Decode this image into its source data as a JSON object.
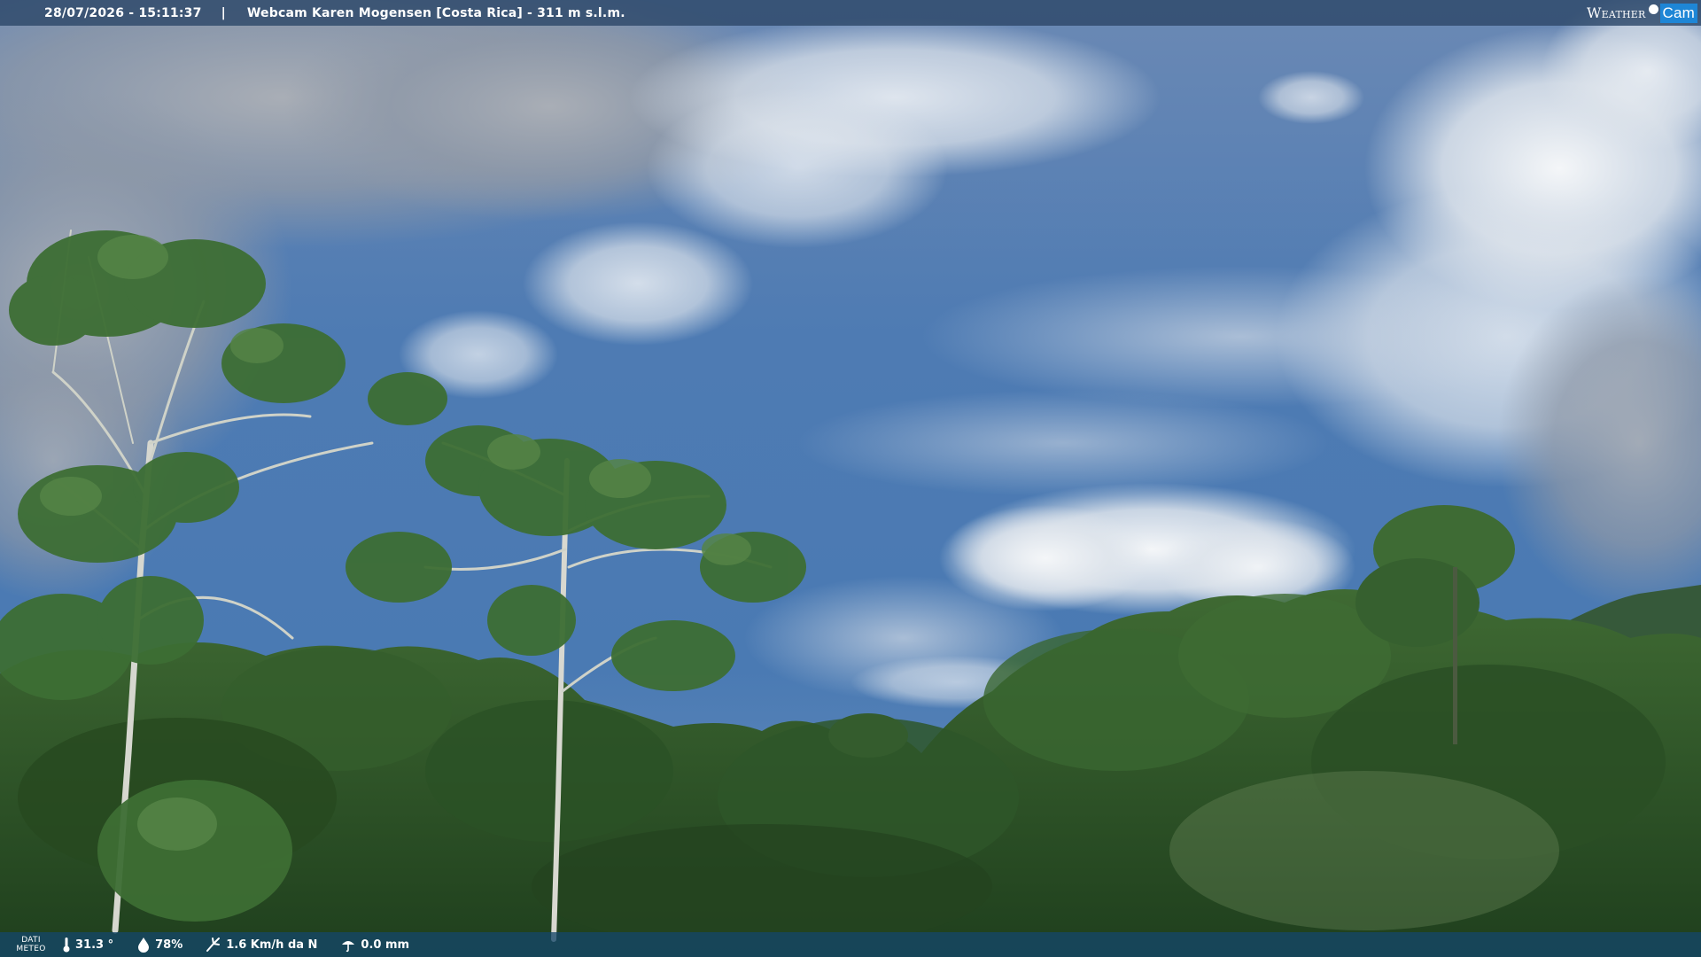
{
  "header": {
    "datetime": "28/07/2026 - 15:11:37",
    "separator": "|",
    "title": "Webcam Karen Mogensen [Costa Rica] - 311 m s.l.m."
  },
  "brand": {
    "word": "Weather",
    "cam": "Cam"
  },
  "weather": {
    "label_line1": "DATI",
    "label_line2": "METEO",
    "temperature": "31.3 °",
    "humidity": "78%",
    "wind": "1.6 Km/h da N",
    "rain": "0.0 mm"
  },
  "icons": {
    "temperature": "thermometer-icon",
    "humidity": "humidity-drop-icon",
    "wind": "wind-icon",
    "rain": "rain-icon"
  },
  "colors": {
    "sky_top": "#5f86b8",
    "sky_bottom": "#3a6aa2",
    "foliage": "#2f5a2a",
    "cam_badge": "#1e86d6"
  }
}
